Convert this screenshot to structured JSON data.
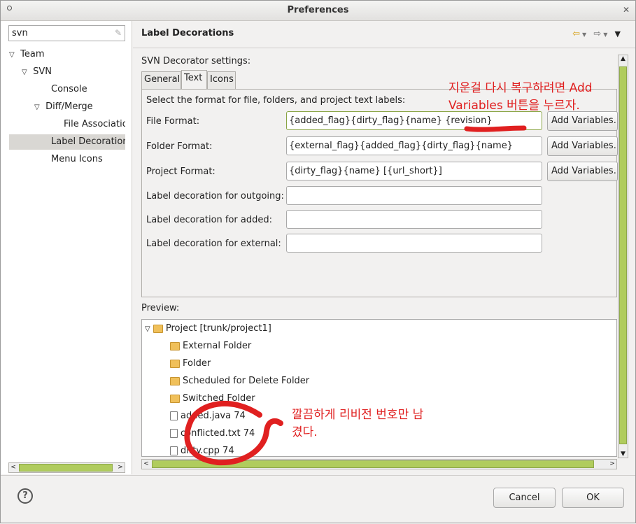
{
  "window": {
    "title": "Preferences"
  },
  "filter": {
    "value": "svn"
  },
  "tree": [
    {
      "label": "Team",
      "expanded": true
    },
    {
      "label": "SVN",
      "expanded": true
    },
    {
      "label": "Console"
    },
    {
      "label": "Diff/Merge",
      "expanded": true
    },
    {
      "label": "File Associatio"
    },
    {
      "label": "Label Decoration",
      "selected": true
    },
    {
      "label": "Menu Icons"
    }
  ],
  "page": {
    "title": "Label Decorations",
    "section_label": "SVN Decorator settings:",
    "tabs": [
      "General",
      "Text",
      "Icons"
    ],
    "active_tab": "Text",
    "instruction": "Select the format for file, folders, and project text labels:",
    "fields": [
      {
        "label": "File Format:",
        "value": "{added_flag}{dirty_flag}{name} {revision}",
        "button": "Add Variables..."
      },
      {
        "label": "Folder Format:",
        "value": "{external_flag}{added_flag}{dirty_flag}{name}",
        "button": "Add Variables..."
      },
      {
        "label": "Project Format:",
        "value": "{dirty_flag}{name} [{url_short}]",
        "button": "Add Variables..."
      },
      {
        "label": "Label decoration for outgoing:",
        "value": ""
      },
      {
        "label": "Label decoration for added:",
        "value": ""
      },
      {
        "label": "Label decoration for external:",
        "value": ""
      }
    ],
    "preview_label": "Preview:",
    "preview_items": [
      "Project [trunk/project1]",
      "External Folder",
      "Folder",
      "Scheduled for Delete Folder",
      "Switched Folder",
      "added.java 74",
      "conflicted.txt 74",
      "dirty.cpp 74"
    ]
  },
  "buttons": {
    "cancel": "Cancel",
    "ok": "OK",
    "help": "?"
  },
  "annotations": {
    "note1_line1": "지운걸 다시 복구하려면 Add",
    "note1_line2": "Variables 버튼을 누르자.",
    "note2_line1": "깔끔하게 리비전 번호만 남",
    "note2_line2": "겼다."
  },
  "colors": {
    "accent_scroll": "#b0cc5d",
    "annotation": "#e02020"
  }
}
